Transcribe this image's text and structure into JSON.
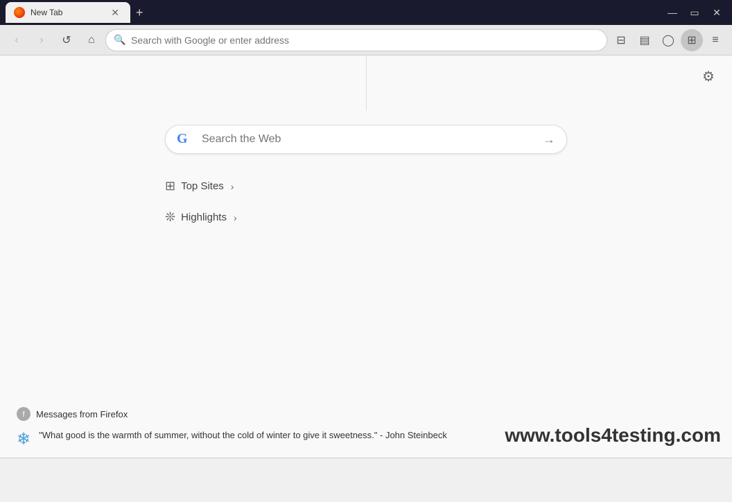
{
  "titlebar": {
    "tab": {
      "title": "New Tab",
      "close_label": "✕"
    },
    "new_tab_btn": "+",
    "window_controls": {
      "minimize": "—",
      "maximize": "▭",
      "close": "✕"
    }
  },
  "navbar": {
    "back_label": "‹",
    "forward_label": "›",
    "refresh_label": "↺",
    "home_label": "⌂",
    "search_placeholder": "Search with Google or enter address",
    "toolbar": {
      "library": "|||",
      "sidebar": "▤",
      "account": "○",
      "extensions": "⊞",
      "menu": "≡"
    }
  },
  "main": {
    "search": {
      "placeholder": "Search the Web",
      "arrow": "→"
    },
    "top_sites": {
      "label": "Top Sites",
      "chevron": "›"
    },
    "highlights": {
      "label": "Highlights",
      "chevron": "›"
    }
  },
  "messages": {
    "title": "Messages from Firefox",
    "item": {
      "text": "\"What good is the warmth of summer, without the cold of winter to give it sweetness.\" - John Steinbeck"
    }
  },
  "watermark": "www.tools4testing.com",
  "settings": {
    "icon": "⚙"
  }
}
